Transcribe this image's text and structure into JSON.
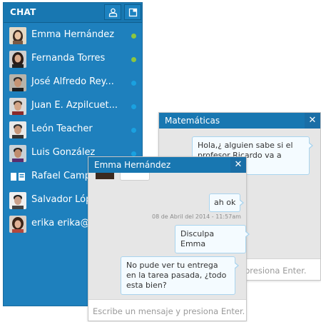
{
  "sidebar": {
    "title": "CHAT",
    "contacts": [
      {
        "name": "Emma Hernández",
        "status": "online"
      },
      {
        "name": "Fernanda Torres",
        "status": "online"
      },
      {
        "name": "José Alfredo Rey...",
        "status": "away"
      },
      {
        "name": "Juan E. Azpilcuet...",
        "status": "away"
      },
      {
        "name": "León Teacher",
        "status": "away"
      },
      {
        "name": "Luis González",
        "status": "away"
      },
      {
        "name": "Rafael Camps",
        "status": "away"
      },
      {
        "name": "Salvador López",
        "status": "away"
      },
      {
        "name": "erika erika@cu",
        "status": "away"
      }
    ]
  },
  "colors": {
    "online": "#8dc63f",
    "away": "#1aa1e0"
  },
  "win_matematicas": {
    "title": "Matemáticas",
    "close": "✕",
    "message": "Hola,¿ alguien sabe si el profesor Ricardo va a impartir",
    "input_placeholder": "presiona Enter."
  },
  "win_emma": {
    "title": "Emma Hernández",
    "close": "✕",
    "messages": [
      {
        "text": "ah ok"
      },
      {
        "text": "Disculpa Emma"
      },
      {
        "text": "No pude ver tu entrega en la tarea pasada, ¿todo esta bien?"
      }
    ],
    "timestamp": "08 de Abril del 2014 - 11:57am",
    "input_placeholder": "Escribe un mensaje y presiona Enter."
  }
}
